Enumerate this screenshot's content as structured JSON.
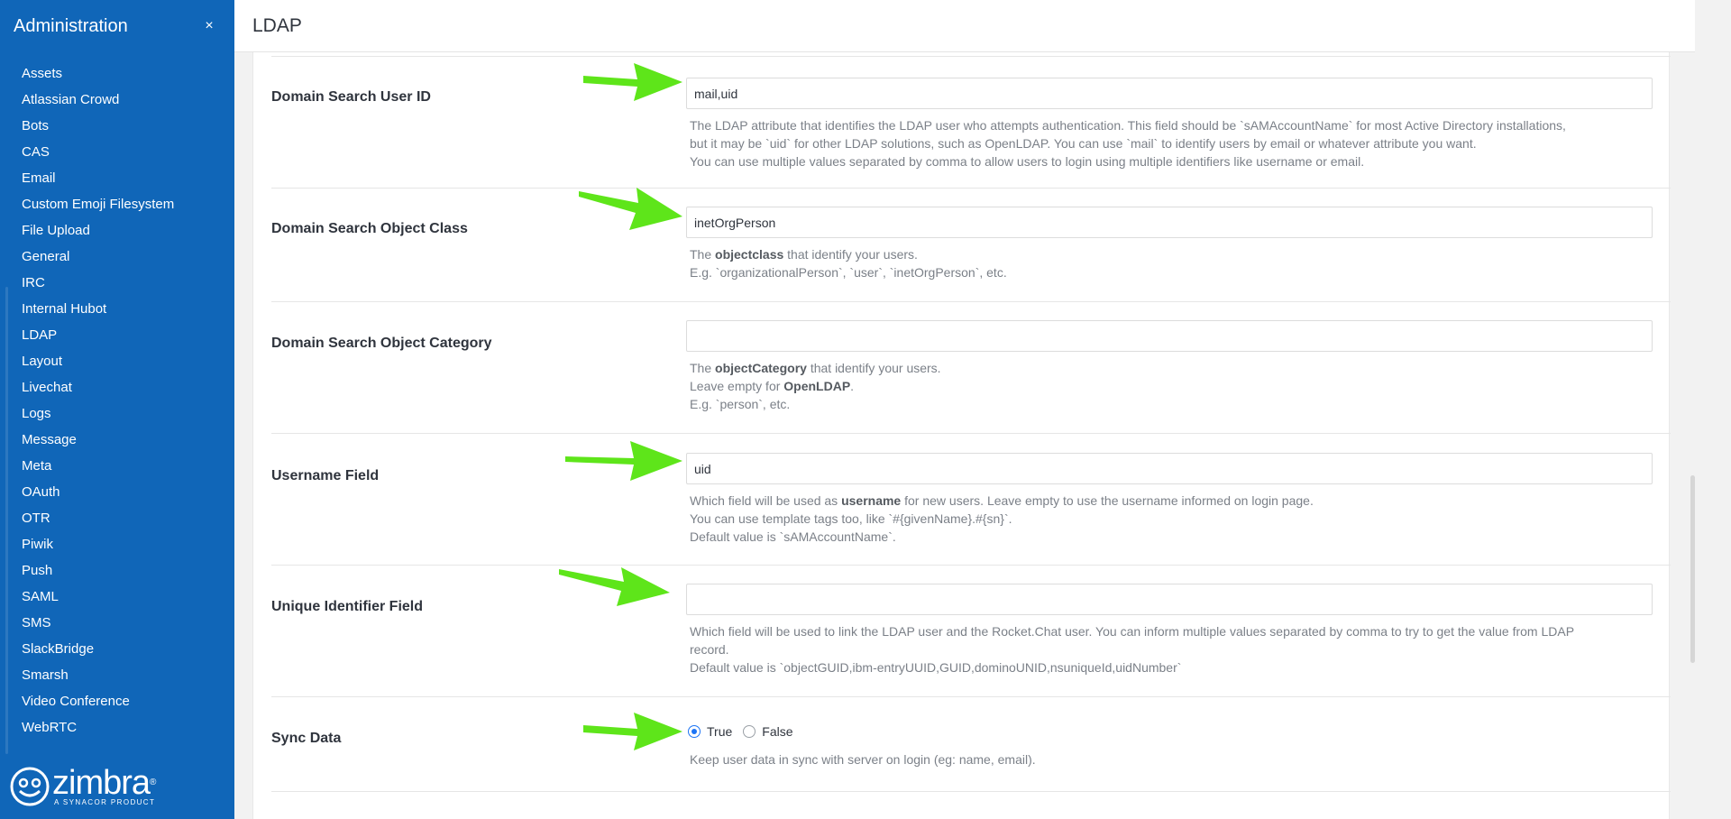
{
  "sidebar": {
    "title": "Administration",
    "close_icon": "×",
    "items": [
      {
        "label": "Assets"
      },
      {
        "label": "Atlassian Crowd"
      },
      {
        "label": "Bots"
      },
      {
        "label": "CAS"
      },
      {
        "label": "Email"
      },
      {
        "label": "Custom Emoji Filesystem"
      },
      {
        "label": "File Upload"
      },
      {
        "label": "General"
      },
      {
        "label": "IRC"
      },
      {
        "label": "Internal Hubot"
      },
      {
        "label": "LDAP"
      },
      {
        "label": "Layout"
      },
      {
        "label": "Livechat"
      },
      {
        "label": "Logs"
      },
      {
        "label": "Message"
      },
      {
        "label": "Meta"
      },
      {
        "label": "OAuth"
      },
      {
        "label": "OTR"
      },
      {
        "label": "Piwik"
      },
      {
        "label": "Push"
      },
      {
        "label": "SAML"
      },
      {
        "label": "SMS"
      },
      {
        "label": "SlackBridge"
      },
      {
        "label": "Smarsh"
      },
      {
        "label": "Video Conference"
      },
      {
        "label": "WebRTC"
      }
    ],
    "brand": {
      "name": "zimbra",
      "reg": "®",
      "sub": "A SYNACOR PRODUCT"
    }
  },
  "header": {
    "title": "LDAP"
  },
  "settings": {
    "search_user_id": {
      "label": "Domain Search User ID",
      "value": "mail,uid",
      "desc": [
        "The LDAP attribute that identifies the LDAP user who attempts authentication. This field should be `sAMAccountName` for most Active Directory installations,",
        "but it may be `uid` for other LDAP solutions, such as OpenLDAP. You can use `mail` to identify users by email or whatever attribute you want.",
        "You can use multiple values separated by comma to allow users to login using multiple identifiers like username or email."
      ]
    },
    "object_class": {
      "label": "Domain Search Object Class",
      "value": "inetOrgPerson",
      "desc1_pre": "The ",
      "desc1_bold": "objectclass",
      "desc1_post": " that identify your users.",
      "desc2": "E.g. `organizationalPerson`, `user`, `inetOrgPerson`, etc."
    },
    "object_category": {
      "label": "Domain Search Object Category",
      "value": "",
      "desc1_pre": "The ",
      "desc1_bold": "objectCategory",
      "desc1_post": " that identify your users.",
      "desc2_pre": "Leave empty for ",
      "desc2_bold": "OpenLDAP",
      "desc2_post": ".",
      "desc3": "E.g. `person`, etc."
    },
    "username_field": {
      "label": "Username Field",
      "value": "uid",
      "desc1_pre": "Which field will be used as ",
      "desc1_bold": "username",
      "desc1_post": " for new users. Leave empty to use the username informed on login page.",
      "desc2": "You can use template tags too, like `#{givenName}.#{sn}`.",
      "desc3": "Default value is `sAMAccountName`."
    },
    "unique_identifier": {
      "label": "Unique Identifier Field",
      "value": "",
      "desc1": "Which field will be used to link the LDAP user and the Rocket.Chat user. You can inform multiple values separated by comma to try to get the value from LDAP",
      "desc2": "record.",
      "desc3": "Default value is `objectGUID,ibm-entryUUID,GUID,dominoUNID,nsuniqueId,uidNumber`"
    },
    "sync_data": {
      "label": "Sync Data",
      "true_label": "True",
      "false_label": "False",
      "selected": "True",
      "desc": "Keep user data in sync with server on login (eg: name, email)."
    }
  },
  "colors": {
    "sidebar_bg": "#1066b8",
    "arrow": "#5ee51a",
    "radio_accent": "#1d74f5"
  }
}
